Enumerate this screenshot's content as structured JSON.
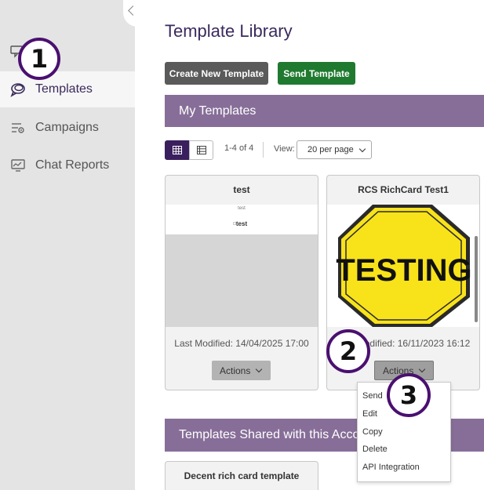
{
  "sidebar": {
    "items": [
      {
        "label": "Templates",
        "icon": "templates-icon",
        "active": true
      },
      {
        "label": "Campaigns",
        "icon": "campaigns-icon",
        "active": false
      },
      {
        "label": "Chat Reports",
        "icon": "chat-reports-icon",
        "active": false
      }
    ]
  },
  "header": {
    "title": "Template Library",
    "create_label": "Create New Template",
    "send_label": "Send Template"
  },
  "my_templates": {
    "heading": "My Templates",
    "count": "1-4 of 4",
    "view_label": "View:",
    "per_page": "20 per page",
    "cards": [
      {
        "title": "test",
        "preview_caption": "test",
        "preview_text": "test",
        "modified": "Last Modified: 14/04/2025 17:00",
        "actions_label": "Actions"
      },
      {
        "title": "RCS RichCard Test1",
        "preview_sign_text": "TESTING",
        "modified": "Last Modified: 16/11/2023 16:12",
        "actions_label": "Actions"
      }
    ],
    "dropdown": [
      "Send",
      "Edit",
      "Copy",
      "Delete",
      "API Integration"
    ]
  },
  "shared": {
    "heading": "Templates Shared with this Account",
    "cards": [
      {
        "title": "Decent rich card template"
      }
    ]
  },
  "callouts": [
    "1",
    "2",
    "3"
  ],
  "colors": {
    "accent_purple": "#3a1f5e",
    "section_bar": "#876e98",
    "send_green": "#1f7a2f",
    "callout_ring": "#4a1070",
    "sign_yellow": "#f8e21a"
  }
}
